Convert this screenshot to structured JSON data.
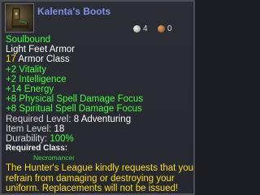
{
  "item": {
    "name": "Kalenta's Boots",
    "icon": "boots-icon"
  },
  "currency": {
    "silver": "4",
    "bronze": "0"
  },
  "binding": "Soulbound",
  "armor_type": "Light Feet Armor",
  "armor_class": {
    "value": "17",
    "label": "Armor Class"
  },
  "bonuses": [
    "+2 Vitality",
    "+2 Intelligence",
    "+14 Energy",
    "+8 Physical Spell Damage Focus",
    "+8 Spiritual Spell Damage Focus"
  ],
  "required_level": {
    "label": "Required Level:",
    "value": "8 Adventuring"
  },
  "item_level": {
    "label": "Item Level:",
    "value": "18"
  },
  "durability": {
    "label": "Durability:",
    "value": "100%"
  },
  "required_class": {
    "label": "Required Class:",
    "value": "Necromancer"
  },
  "flavor_lines": [
    "The Hunter's League kindly requests that you",
    "refrain from damaging or destroying your",
    "uniform. Replacements will not be issued!"
  ],
  "colors": {
    "name": "#7f8fe8",
    "bonus_green": "#3cff3c",
    "flavor_yellow": "#ffde00",
    "class_green": "#34d83f"
  }
}
